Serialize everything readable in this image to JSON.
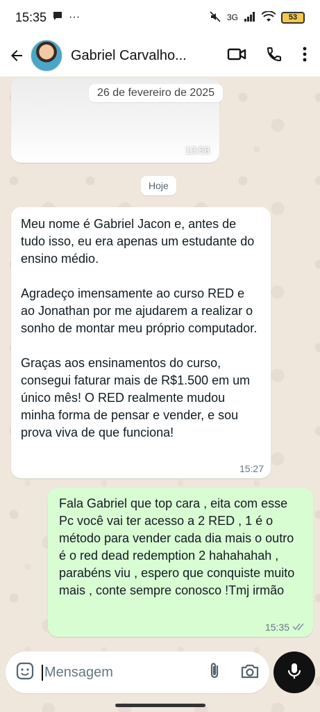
{
  "status_bar": {
    "time": "15:35",
    "network": "3G",
    "battery": "53"
  },
  "header": {
    "contact_name": "Gabriel Carvalho..."
  },
  "chat": {
    "image_message": {
      "date_overlay": "26 de fevereiro de 2025",
      "time": "13:58"
    },
    "day_separator": "Hoje",
    "incoming": {
      "text": "Meu nome é Gabriel Jacon e, antes de tudo isso, eu era apenas um estudante do ensino médio.\n\nAgradeço imensamente ao curso RED e ao Jonathan por me ajudarem a realizar o sonho de montar meu próprio computador.\n\nGraças aos ensinamentos do curso, consegui faturar mais de R$1.500 em um único mês! O RED realmente mudou minha forma de pensar e vender, e sou prova viva de que funciona!",
      "time": "15:27"
    },
    "outgoing": {
      "text": "Fala Gabriel que top cara , eita com esse Pc você vai ter acesso a 2 RED , 1 é o método para vender cada dia mais o outro é o red dead redemption 2 hahahahah , parabéns viu , espero que conquiste muito mais , conte sempre conosco !Tmj irmão",
      "time": "15:35"
    }
  },
  "composer": {
    "placeholder": "Mensagem"
  },
  "icons": {
    "back": "arrow-left-icon",
    "video": "video-call-icon",
    "phone": "phone-icon",
    "menu": "more-vert-icon",
    "sticker": "sticker-icon",
    "attach": "paperclip-icon",
    "camera": "camera-icon",
    "mic": "microphone-icon",
    "read_receipt": "double-check-icon"
  },
  "colors": {
    "outgoing_bubble": "#d9fdd3",
    "incoming_bubble": "#ffffff",
    "mic_button": "#111111"
  }
}
